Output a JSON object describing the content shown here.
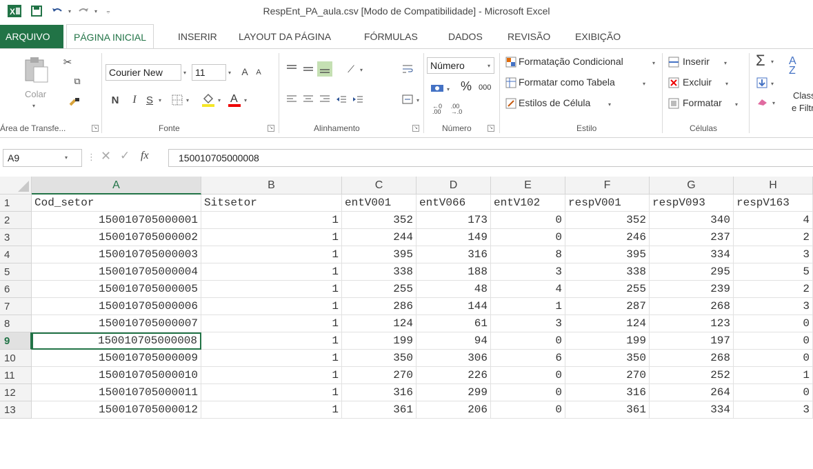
{
  "window": {
    "title": "RespEnt_PA_aula.csv  [Modo de Compatibilidade] - Microsoft Excel"
  },
  "tabs": [
    "ARQUIVO",
    "PÁGINA INICIAL",
    "INSERIR",
    "LAYOUT DA PÁGINA",
    "FÓRMULAS",
    "DADOS",
    "REVISÃO",
    "EXIBIÇÃO"
  ],
  "ribbon": {
    "clipboard": {
      "paste_label": "Colar",
      "group_label": "Área de Transfe..."
    },
    "font": {
      "name": "Courier New",
      "size": "11",
      "grow": "A",
      "shrink": "A",
      "bold": "N",
      "italic": "I",
      "underline": "S",
      "group_label": "Fonte"
    },
    "alignment": {
      "group_label": "Alinhamento"
    },
    "number": {
      "format": "Número",
      "percent": "%",
      "thousands": "000",
      "group_label": "Número"
    },
    "styles": {
      "conditional": "Formatação Condicional",
      "as_table": "Formatar como Tabela",
      "cell_styles": "Estilos de Célula",
      "group_label": "Estilo"
    },
    "cells": {
      "insert": "Inserir",
      "delete": "Excluir",
      "format": "Formatar",
      "group_label": "Células"
    },
    "editing": {
      "sort_line1": "Classi",
      "sort_line2": "e Filtr",
      "sigma": "Σ"
    }
  },
  "formula_bar": {
    "name_box": "A9",
    "fx": "fx",
    "value": "150010705000008"
  },
  "columns": [
    "A",
    "B",
    "C",
    "D",
    "E",
    "F",
    "G",
    "H"
  ],
  "rows": [
    "1",
    "2",
    "3",
    "4",
    "5",
    "6",
    "7",
    "8",
    "9",
    "10",
    "11",
    "12",
    "13"
  ],
  "active_row": "9",
  "active_col": "A",
  "cells": [
    [
      "Cod_setor",
      "Sitsetor",
      "entV001",
      "entV066",
      "entV102",
      "respV001",
      "respV093",
      "respV163"
    ],
    [
      "150010705000001",
      "1",
      "352",
      "173",
      "0",
      "352",
      "340",
      "4"
    ],
    [
      "150010705000002",
      "1",
      "244",
      "149",
      "0",
      "246",
      "237",
      "2"
    ],
    [
      "150010705000003",
      "1",
      "395",
      "316",
      "8",
      "395",
      "334",
      "3"
    ],
    [
      "150010705000004",
      "1",
      "338",
      "188",
      "3",
      "338",
      "295",
      "5"
    ],
    [
      "150010705000005",
      "1",
      "255",
      "48",
      "4",
      "255",
      "239",
      "2"
    ],
    [
      "150010705000006",
      "1",
      "286",
      "144",
      "1",
      "287",
      "268",
      "3"
    ],
    [
      "150010705000007",
      "1",
      "124",
      "61",
      "3",
      "124",
      "123",
      "0"
    ],
    [
      "150010705000008",
      "1",
      "199",
      "94",
      "0",
      "199",
      "197",
      "0"
    ],
    [
      "150010705000009",
      "1",
      "350",
      "306",
      "6",
      "350",
      "268",
      "0"
    ],
    [
      "150010705000010",
      "1",
      "270",
      "226",
      "0",
      "270",
      "252",
      "1"
    ],
    [
      "150010705000011",
      "1",
      "316",
      "299",
      "0",
      "316",
      "264",
      "0"
    ],
    [
      "150010705000012",
      "1",
      "361",
      "206",
      "0",
      "361",
      "334",
      "3"
    ]
  ]
}
